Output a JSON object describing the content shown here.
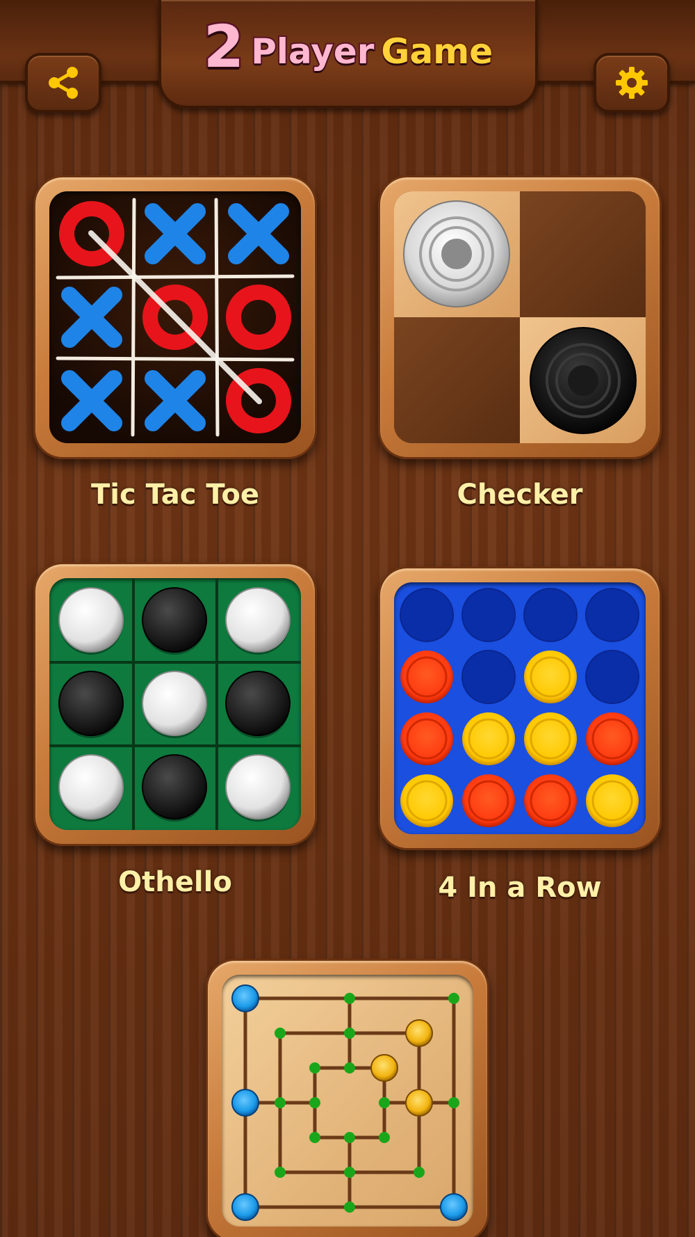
{
  "header": {
    "title_number": "2",
    "title_player": "Player",
    "title_game": "Game",
    "share_icon": "share-icon",
    "settings_icon": "gear-icon"
  },
  "games": [
    {
      "id": "tic-tac-toe",
      "label": "Tic Tac Toe"
    },
    {
      "id": "checker",
      "label": "Checker"
    },
    {
      "id": "othello",
      "label": "Othello"
    },
    {
      "id": "four-in-a-row",
      "label": "4 In a Row"
    },
    {
      "id": "nine-mens-morris",
      "label": ""
    }
  ],
  "boards": {
    "tic_tac_toe": [
      [
        "O",
        "X",
        "X"
      ],
      [
        "X",
        "O",
        "O"
      ],
      [
        "X",
        "X",
        "O"
      ]
    ],
    "checker": [
      [
        "white",
        ""
      ],
      [
        "",
        "black"
      ]
    ],
    "othello": [
      [
        "white",
        "black",
        "white"
      ],
      [
        "black",
        "white",
        "black"
      ],
      [
        "white",
        "black",
        "white"
      ]
    ],
    "four_in_a_row": [
      [
        "empty",
        "empty",
        "empty",
        "empty"
      ],
      [
        "red",
        "empty",
        "yellow",
        "empty"
      ],
      [
        "red",
        "yellow",
        "yellow",
        "red"
      ],
      [
        "yellow",
        "red",
        "red",
        "yellow"
      ]
    ],
    "nine_mens_morris_pieces": [
      {
        "point": "outer-top-left",
        "color": "blue"
      },
      {
        "point": "outer-mid-left",
        "color": "blue"
      },
      {
        "point": "outer-bottom-left",
        "color": "blue"
      },
      {
        "point": "outer-bottom-right",
        "color": "blue"
      },
      {
        "point": "middle-top-right",
        "color": "yellow"
      },
      {
        "point": "inner-top-right",
        "color": "yellow"
      },
      {
        "point": "middle-mid-right",
        "color": "yellow"
      }
    ]
  },
  "colors": {
    "o_red": "#e8141b",
    "x_blue": "#1e84e8",
    "othello_green": "#0e7a3e",
    "four_row_blue": "#1a4fe0",
    "piece_red": "#ff3a10",
    "piece_yellow": "#ffc800",
    "mill_blue": "#1a9ae8",
    "mill_yellow": "#f2b410",
    "mill_point_green": "#1aa61a",
    "title_pink": "#ffb8cf",
    "title_yellow": "#ffd23a",
    "label_cream": "#fff0a8"
  }
}
